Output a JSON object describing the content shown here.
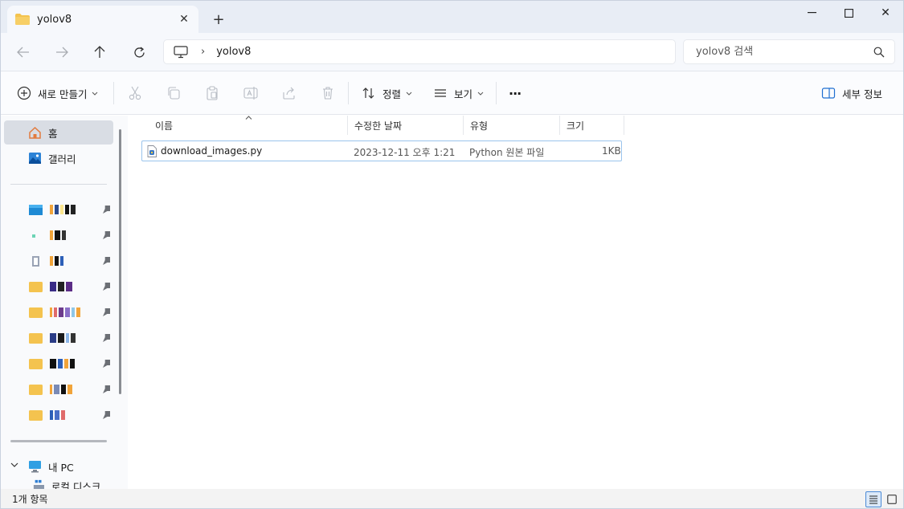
{
  "window": {
    "tab_title": "yolov8",
    "tab_close": "✕",
    "new_tab": "+",
    "minimize": "—",
    "close": "✕"
  },
  "address": {
    "separator": "›",
    "crumb": "yolov8",
    "search_placeholder": "yolov8 검색"
  },
  "toolbar": {
    "new_label": "새로 만들기",
    "sort_label": "정렬",
    "view_label": "보기",
    "more_label": "···",
    "details_label": "세부 정보"
  },
  "sidebar": {
    "home_label": "홈",
    "gallery_label": "갤러리",
    "pc_label": "내 PC",
    "cut_label": "로컬 디스크 (C:)",
    "accent": "#f2c55a"
  },
  "table": {
    "headers": [
      "이름",
      "수정한 날짜",
      "유형",
      "크기"
    ],
    "rows": [
      {
        "name": "download_images.py",
        "date": "2023-12-11 오후 1:21",
        "type": "Python 원본 파일",
        "size": "1KB"
      }
    ]
  },
  "status": {
    "item_count": "1개 항목"
  },
  "colors": {
    "folder": "#f4c34f",
    "selection_border": "#9ac4ec",
    "accent_blue": "#1f6fd1"
  }
}
